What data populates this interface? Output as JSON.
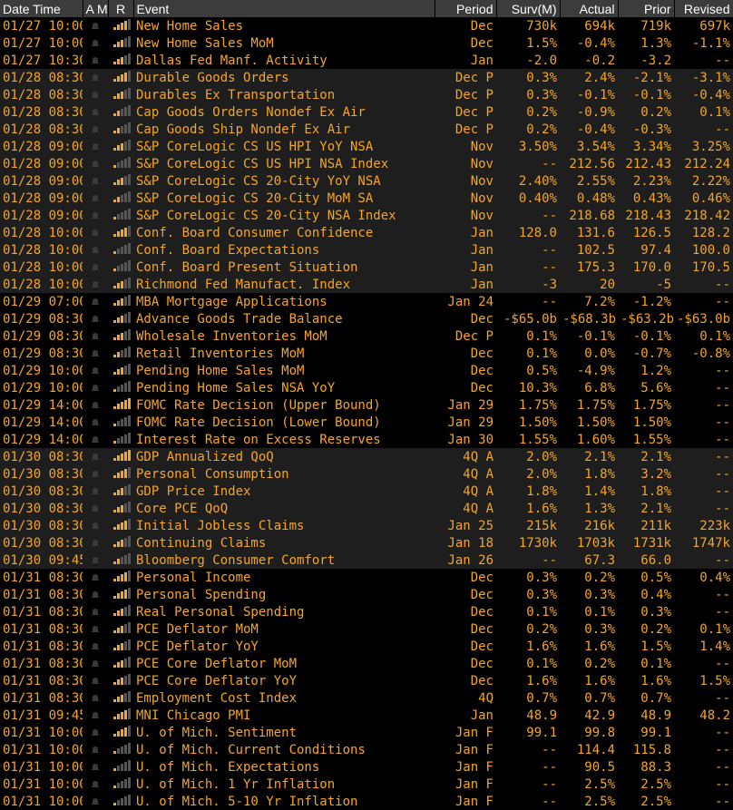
{
  "headers": {
    "date_time": "Date Time",
    "am": "A M",
    "r": "R",
    "event": "Event",
    "period": "Period",
    "surv": "Surv(M)",
    "actual": "Actual",
    "prior": "Prior",
    "revised": "Revised"
  },
  "colors": {
    "accent": "#f5a623",
    "header_bg": "#3c3c3c",
    "alt_row": "#1e1e1e",
    "bar_on": "#f5a623",
    "bar_off": "#555555"
  },
  "rows": [
    {
      "d": "01/27 10:00",
      "r": 4,
      "e": "New Home Sales",
      "p": "Dec",
      "s": "730k",
      "a": "694k",
      "pr": "719k",
      "rv": "697k",
      "g": 2
    },
    {
      "d": "01/27 10:00",
      "r": 3,
      "e": "New Home Sales MoM",
      "p": "Dec",
      "s": "1.5%",
      "a": "-0.4%",
      "pr": "1.3%",
      "rv": "-1.1%",
      "g": 2
    },
    {
      "d": "01/27 10:30",
      "r": 3,
      "e": "Dallas Fed Manf. Activity",
      "p": "Jan",
      "s": "-2.0",
      "a": "-0.2",
      "pr": "-3.2",
      "rv": "--",
      "g": 2
    },
    {
      "d": "01/28 08:30",
      "r": 4,
      "e": "Durable Goods Orders",
      "p": "Dec P",
      "s": "0.3%",
      "a": "2.4%",
      "pr": "-2.1%",
      "rv": "-3.1%",
      "g": 1
    },
    {
      "d": "01/28 08:30",
      "r": 3,
      "e": "Durables Ex Transportation",
      "p": "Dec P",
      "s": "0.3%",
      "a": "-0.1%",
      "pr": "-0.1%",
      "rv": "-0.4%",
      "g": 1
    },
    {
      "d": "01/28 08:30",
      "r": 2,
      "e": "Cap Goods Orders Nondef Ex Air",
      "p": "Dec P",
      "s": "0.2%",
      "a": "-0.9%",
      "pr": "0.2%",
      "rv": "0.1%",
      "g": 1
    },
    {
      "d": "01/28 08:30",
      "r": 2,
      "e": "Cap Goods Ship Nondef Ex Air",
      "p": "Dec P",
      "s": "0.2%",
      "a": "-0.4%",
      "pr": "-0.3%",
      "rv": "--",
      "g": 1
    },
    {
      "d": "01/28 09:00",
      "r": 3,
      "e": "S&P CoreLogic CS US HPI YoY NSA",
      "p": "Nov",
      "s": "3.50%",
      "a": "3.54%",
      "pr": "3.34%",
      "rv": "3.25%",
      "g": 1
    },
    {
      "d": "01/28 09:00",
      "r": 1,
      "e": "S&P CoreLogic CS US HPI NSA Index",
      "p": "Nov",
      "s": "--",
      "a": "212.56",
      "pr": "212.43",
      "rv": "212.24",
      "g": 1
    },
    {
      "d": "01/28 09:00",
      "r": 3,
      "e": "S&P CoreLogic CS 20-City YoY NSA",
      "p": "Nov",
      "s": "2.40%",
      "a": "2.55%",
      "pr": "2.23%",
      "rv": "2.22%",
      "g": 1
    },
    {
      "d": "01/28 09:00",
      "r": 2,
      "e": "S&P CoreLogic CS 20-City MoM SA",
      "p": "Nov",
      "s": "0.40%",
      "a": "0.48%",
      "pr": "0.43%",
      "rv": "0.46%",
      "g": 1
    },
    {
      "d": "01/28 09:00",
      "r": 1,
      "e": "S&P CoreLogic CS 20-City NSA Index",
      "p": "Nov",
      "s": "--",
      "a": "218.68",
      "pr": "218.43",
      "rv": "218.42",
      "g": 1
    },
    {
      "d": "01/28 10:00",
      "r": 4,
      "e": "Conf. Board Consumer Confidence",
      "p": "Jan",
      "s": "128.0",
      "a": "131.6",
      "pr": "126.5",
      "rv": "128.2",
      "g": 1
    },
    {
      "d": "01/28 10:00",
      "r": 1,
      "e": "Conf. Board Expectations",
      "p": "Jan",
      "s": "--",
      "a": "102.5",
      "pr": "97.4",
      "rv": "100.0",
      "g": 1
    },
    {
      "d": "01/28 10:00",
      "r": 1,
      "e": "Conf. Board Present Situation",
      "p": "Jan",
      "s": "--",
      "a": "175.3",
      "pr": "170.0",
      "rv": "170.5",
      "g": 1
    },
    {
      "d": "01/28 10:00",
      "r": 3,
      "e": "Richmond Fed Manufact. Index",
      "p": "Jan",
      "s": "-3",
      "a": "20",
      "pr": "-5",
      "rv": "--",
      "g": 1
    },
    {
      "d": "01/29 07:00",
      "r": 3,
      "e": "MBA Mortgage Applications",
      "p": "Jan 24",
      "s": "--",
      "a": "7.2%",
      "pr": "-1.2%",
      "rv": "--",
      "g": 2
    },
    {
      "d": "01/29 08:30",
      "r": 3,
      "e": "Advance Goods Trade Balance",
      "p": "Dec",
      "s": "-$65.0b",
      "a": "-$68.3b",
      "pr": "-$63.2b",
      "rv": "-$63.0b",
      "g": 2
    },
    {
      "d": "01/29 08:30",
      "r": 3,
      "e": "Wholesale Inventories MoM",
      "p": "Dec P",
      "s": "0.1%",
      "a": "-0.1%",
      "pr": "-0.1%",
      "rv": "0.1%",
      "g": 2
    },
    {
      "d": "01/29 08:30",
      "r": 2,
      "e": "Retail Inventories MoM",
      "p": "Dec",
      "s": "0.1%",
      "a": "0.0%",
      "pr": "-0.7%",
      "rv": "-0.8%",
      "g": 2
    },
    {
      "d": "01/29 10:00",
      "r": 3,
      "e": "Pending Home Sales MoM",
      "p": "Dec",
      "s": "0.5%",
      "a": "-4.9%",
      "pr": "1.2%",
      "rv": "--",
      "g": 2
    },
    {
      "d": "01/29 10:00",
      "r": 1,
      "e": "Pending Home Sales NSA YoY",
      "p": "Dec",
      "s": "10.3%",
      "a": "6.8%",
      "pr": "5.6%",
      "rv": "--",
      "g": 2
    },
    {
      "d": "01/29 14:00",
      "r": 5,
      "e": "FOMC Rate Decision (Upper Bound)",
      "p": "Jan 29",
      "s": "1.75%",
      "a": "1.75%",
      "pr": "1.75%",
      "rv": "--",
      "g": 2
    },
    {
      "d": "01/29 14:00",
      "r": 1,
      "e": "FOMC Rate Decision (Lower Bound)",
      "p": "Jan 29",
      "s": "1.50%",
      "a": "1.50%",
      "pr": "1.50%",
      "rv": "--",
      "g": 2
    },
    {
      "d": "01/29 14:00",
      "r": 1,
      "e": "Interest Rate on Excess Reserves",
      "p": "Jan 30",
      "s": "1.55%",
      "a": "1.60%",
      "pr": "1.55%",
      "rv": "--",
      "g": 2
    },
    {
      "d": "01/30 08:30",
      "r": 5,
      "e": "GDP Annualized QoQ",
      "p": "4Q A",
      "s": "2.0%",
      "a": "2.1%",
      "pr": "2.1%",
      "rv": "--",
      "g": 1
    },
    {
      "d": "01/30 08:30",
      "r": 4,
      "e": "Personal Consumption",
      "p": "4Q A",
      "s": "2.0%",
      "a": "1.8%",
      "pr": "3.2%",
      "rv": "--",
      "g": 1
    },
    {
      "d": "01/30 08:30",
      "r": 3,
      "e": "GDP Price Index",
      "p": "4Q A",
      "s": "1.8%",
      "a": "1.4%",
      "pr": "1.8%",
      "rv": "--",
      "g": 1
    },
    {
      "d": "01/30 08:30",
      "r": 3,
      "e": "Core PCE QoQ",
      "p": "4Q A",
      "s": "1.6%",
      "a": "1.3%",
      "pr": "2.1%",
      "rv": "--",
      "g": 1
    },
    {
      "d": "01/30 08:30",
      "r": 4,
      "e": "Initial Jobless Claims",
      "p": "Jan 25",
      "s": "215k",
      "a": "216k",
      "pr": "211k",
      "rv": "223k",
      "g": 1
    },
    {
      "d": "01/30 08:30",
      "r": 3,
      "e": "Continuing Claims",
      "p": "Jan 18",
      "s": "1730k",
      "a": "1703k",
      "pr": "1731k",
      "rv": "1747k",
      "g": 1
    },
    {
      "d": "01/30 09:45",
      "r": 2,
      "e": "Bloomberg Consumer Comfort",
      "p": "Jan 26",
      "s": "--",
      "a": "67.3",
      "pr": "66.0",
      "rv": "--",
      "g": 1
    },
    {
      "d": "01/31 08:30",
      "r": 4,
      "e": "Personal Income",
      "p": "Dec",
      "s": "0.3%",
      "a": "0.2%",
      "pr": "0.5%",
      "rv": "0.4%",
      "g": 2
    },
    {
      "d": "01/31 08:30",
      "r": 4,
      "e": "Personal Spending",
      "p": "Dec",
      "s": "0.3%",
      "a": "0.3%",
      "pr": "0.4%",
      "rv": "--",
      "g": 2
    },
    {
      "d": "01/31 08:30",
      "r": 3,
      "e": "Real Personal Spending",
      "p": "Dec",
      "s": "0.1%",
      "a": "0.1%",
      "pr": "0.3%",
      "rv": "--",
      "g": 2
    },
    {
      "d": "01/31 08:30",
      "r": 3,
      "e": "PCE Deflator MoM",
      "p": "Dec",
      "s": "0.2%",
      "a": "0.3%",
      "pr": "0.2%",
      "rv": "0.1%",
      "g": 2
    },
    {
      "d": "01/31 08:30",
      "r": 3,
      "e": "PCE Deflator YoY",
      "p": "Dec",
      "s": "1.6%",
      "a": "1.6%",
      "pr": "1.5%",
      "rv": "1.4%",
      "g": 2
    },
    {
      "d": "01/31 08:30",
      "r": 3,
      "e": "PCE Core Deflator MoM",
      "p": "Dec",
      "s": "0.1%",
      "a": "0.2%",
      "pr": "0.1%",
      "rv": "--",
      "g": 2
    },
    {
      "d": "01/31 08:30",
      "r": 3,
      "e": "PCE Core Deflator YoY",
      "p": "Dec",
      "s": "1.6%",
      "a": "1.6%",
      "pr": "1.6%",
      "rv": "1.5%",
      "g": 2
    },
    {
      "d": "01/31 08:30",
      "r": 3,
      "e": "Employment Cost Index",
      "p": "4Q",
      "s": "0.7%",
      "a": "0.7%",
      "pr": "0.7%",
      "rv": "--",
      "g": 2
    },
    {
      "d": "01/31 09:45",
      "r": 4,
      "e": "MNI Chicago PMI",
      "p": "Jan",
      "s": "48.9",
      "a": "42.9",
      "pr": "48.9",
      "rv": "48.2",
      "g": 2
    },
    {
      "d": "01/31 10:00",
      "r": 4,
      "e": "U. of Mich. Sentiment",
      "p": "Jan F",
      "s": "99.1",
      "a": "99.8",
      "pr": "99.1",
      "rv": "--",
      "g": 2
    },
    {
      "d": "01/31 10:00",
      "r": 1,
      "e": "U. of Mich. Current Conditions",
      "p": "Jan F",
      "s": "--",
      "a": "114.4",
      "pr": "115.8",
      "rv": "--",
      "g": 2
    },
    {
      "d": "01/31 10:00",
      "r": 1,
      "e": "U. of Mich. Expectations",
      "p": "Jan F",
      "s": "--",
      "a": "90.5",
      "pr": "88.3",
      "rv": "--",
      "g": 2
    },
    {
      "d": "01/31 10:00",
      "r": 1,
      "e": "U. of Mich. 1 Yr Inflation",
      "p": "Jan F",
      "s": "--",
      "a": "2.5%",
      "pr": "2.5%",
      "rv": "--",
      "g": 2
    },
    {
      "d": "01/31 10:00",
      "r": 1,
      "e": "U. of Mich. 5-10 Yr Inflation",
      "p": "Jan F",
      "s": "--",
      "a": "2.5%",
      "pr": "2.5%",
      "rv": "--",
      "g": 2
    }
  ]
}
